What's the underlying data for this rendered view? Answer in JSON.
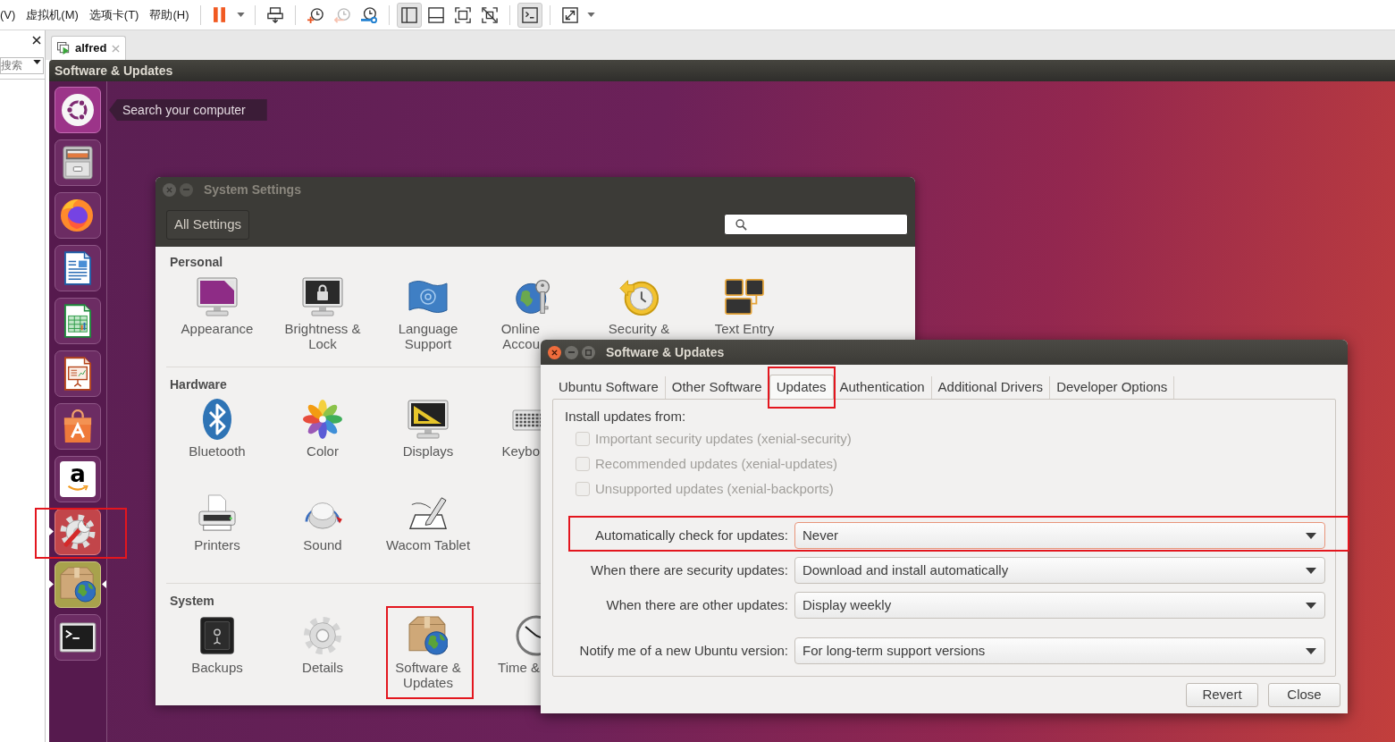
{
  "menu": [
    "(V)",
    "虚拟机(M)",
    "选项卡(T)",
    "帮助(H)"
  ],
  "toolbar": [
    {
      "pressed": false,
      "disabled": false
    },
    {
      "pressed": false,
      "disabled": false
    },
    {
      "pressed": false,
      "disabled": false
    },
    {
      "pressed": false,
      "disabled": true
    },
    {
      "pressed": false,
      "disabled": false
    },
    {
      "pressed": true,
      "disabled": false
    },
    {
      "pressed": false,
      "disabled": false
    },
    {
      "pressed": false,
      "disabled": false
    },
    {
      "pressed": false,
      "disabled": false
    },
    {
      "pressed": true,
      "disabled": false
    },
    {
      "pressed": false,
      "disabled": false
    }
  ],
  "library": {
    "search": {
      "placeholder": "搜索"
    }
  },
  "vm_tabs": [
    {
      "label": "alfred",
      "selected": true
    }
  ],
  "top_bar": {
    "title": "Software & Updates"
  },
  "launcher": [
    {
      "running": false,
      "focused": false,
      "highlighted": false
    },
    {
      "running": false,
      "focused": false,
      "highlighted": false
    },
    {
      "running": false,
      "focused": false,
      "highlighted": false
    },
    {
      "running": false,
      "focused": false,
      "highlighted": false
    },
    {
      "running": false,
      "focused": false,
      "highlighted": false
    },
    {
      "running": false,
      "focused": false,
      "highlighted": false
    },
    {
      "running": false,
      "focused": false,
      "highlighted": false
    },
    {
      "running": false,
      "focused": false,
      "highlighted": false,
      "logo_text": "a"
    },
    {
      "running": true,
      "focused": false,
      "highlighted": true
    },
    {
      "running": true,
      "focused": true,
      "highlighted": false
    },
    {
      "running": false,
      "focused": false,
      "highlighted": false
    }
  ],
  "dash_tooltip": {
    "text": "Search your computer"
  },
  "system_settings": {
    "title": "System Settings",
    "focused": false,
    "all_settings": "All Settings",
    "sections": [
      {
        "title": "Personal",
        "rows": [
          [
            {
              "label": "Appearance",
              "clipped": false,
              "highlighted": false
            },
            {
              "label": "Brightness & Lock",
              "clipped": false,
              "highlighted": false
            },
            {
              "label": "Language Support",
              "clipped": false,
              "highlighted": false
            },
            {
              "label": "Online Accou",
              "clipped": true,
              "highlighted": false
            },
            {
              "label": "Security &",
              "clipped": false,
              "highlighted": false
            },
            {
              "label": "Text Entry",
              "clipped": false,
              "highlighted": false
            }
          ]
        ]
      },
      {
        "title": "Hardware",
        "rows": [
          [
            {
              "label": "Bluetooth",
              "clipped": false,
              "highlighted": false
            },
            {
              "label": "Color",
              "clipped": false,
              "highlighted": false
            },
            {
              "label": "Displays",
              "clipped": false,
              "highlighted": false
            },
            {
              "label": "Keybo",
              "clipped": true,
              "highlighted": false
            }
          ],
          [
            {
              "label": "Printers",
              "clipped": false,
              "highlighted": false
            },
            {
              "label": "Sound",
              "clipped": false,
              "highlighted": false
            },
            {
              "label": "Wacom Tablet",
              "clipped": false,
              "highlighted": false
            }
          ]
        ]
      },
      {
        "title": "System",
        "rows": [
          [
            {
              "label": "Backups",
              "clipped": false,
              "highlighted": false
            },
            {
              "label": "Details",
              "clipped": false,
              "highlighted": false
            },
            {
              "label": "Software & Updates",
              "clipped": false,
              "highlighted": true
            },
            {
              "label": "Time &",
              "clipped": true,
              "highlighted": false
            }
          ]
        ]
      }
    ]
  },
  "dialog": {
    "title": "Software & Updates",
    "focused": true,
    "tabs": [
      {
        "label": "Ubuntu Software",
        "selected": false,
        "highlighted": false
      },
      {
        "label": "Other Software",
        "selected": false,
        "highlighted": false
      },
      {
        "label": "Updates",
        "selected": true,
        "highlighted": true
      },
      {
        "label": "Authentication",
        "selected": false,
        "highlighted": false
      },
      {
        "label": "Additional Drivers",
        "selected": false,
        "highlighted": false
      },
      {
        "label": "Developer Options",
        "selected": false,
        "highlighted": false
      }
    ],
    "install_from": "Install updates from:",
    "sources": [
      {
        "label": "Important security updates (xenial-security)",
        "checked": false,
        "disabled": true
      },
      {
        "label": "Recommended updates (xenial-updates)",
        "checked": false,
        "disabled": true
      },
      {
        "label": "Unsupported updates (xenial-backports)",
        "checked": false,
        "disabled": true
      }
    ],
    "update_settings": [
      {
        "label": "Automatically check for updates:",
        "value": "Never",
        "focused": true,
        "highlighted": true
      },
      {
        "label": "When there are security updates:",
        "value": "Download and install automatically",
        "focused": false,
        "highlighted": false
      },
      {
        "label": "When there are other updates:",
        "value": "Display weekly",
        "focused": false,
        "highlighted": false
      }
    ],
    "release_settings": [
      {
        "label": "Notify me of a new Ubuntu version:",
        "value": "For long-term support versions",
        "focused": false,
        "highlighted": false
      }
    ],
    "buttons": [
      "Revert",
      "Close"
    ]
  }
}
